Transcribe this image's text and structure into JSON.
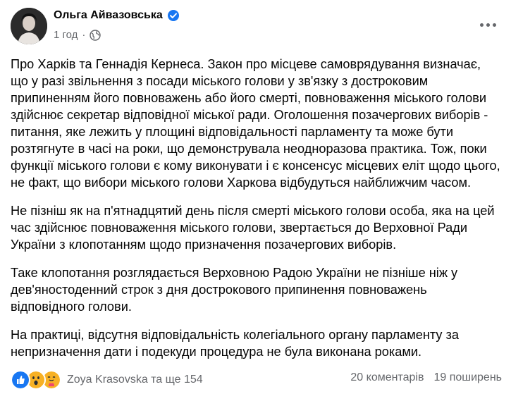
{
  "post": {
    "author": "Ольга Айвазовська",
    "timestamp": "1 год",
    "dot": "·",
    "paragraphs": [
      "Про Харків та Геннадія Кернеса. Закон про місцеве самоврядування визначає, що у разі звільнення з посади міського голови у зв'язку з достроковим припиненням його повноважень або його смерті, повноваження міського голови здійснює секретар відповідної міської ради. Оголошення позачергових виборів - питання, яке лежить у площині відповідальності парламенту та може бути розтягнуте в часі на роки, що демонструвала неодноразова практика. Тож, поки функції міського голови є кому виконувати і є консенсус місцевих еліт щодо цього, не факт, що вибори міського голови Харкова відбудуться найближчим часом.",
      "Не пізніш як на п'ятнадцятий день після смерті міського голови особа, яка на цей час здійснює повноваження міського голови, звертається до Верховної Ради України з клопотанням щодо призначення позачергових виборів.",
      "Таке клопотання розглядається Верховною Радою України не пізніше ніж у дев'яностоденний строк з дня дострокового припинення повноважень відповідного голови.",
      "На практиці, відсутня відповідальність колегіального органу парламенту за непризначення дати і подекуди процедура не була виконана роками."
    ]
  },
  "footer": {
    "reactors": "Zoya Krasovska та ще 154",
    "comments": "20 коментарів",
    "shares": "19 поширень",
    "reactions": [
      "like-icon",
      "wow-icon",
      "care-icon"
    ]
  },
  "colors": {
    "verified": "#1877f2",
    "secondary_text": "#65676b",
    "like": "#1877f2",
    "wow": "#f7b125",
    "care": "#f7b125"
  }
}
